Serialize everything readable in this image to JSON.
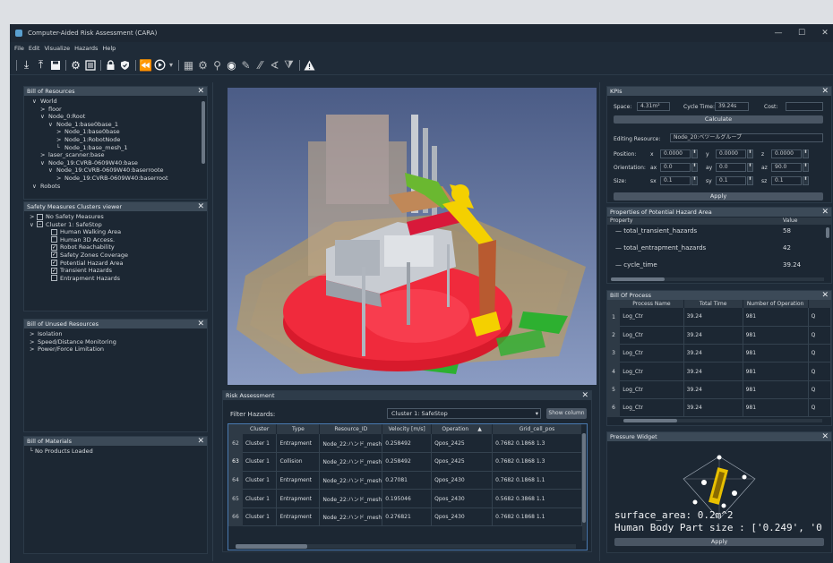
{
  "app": {
    "title": "Computer-Aided Risk Assessment (CARA)",
    "controls": [
      "—",
      "☐",
      "✕"
    ]
  },
  "menu": [
    "File",
    "Edit",
    "Visualize",
    "Hazards",
    "Help"
  ],
  "bom": {
    "title": "Bill of Resources",
    "items": [
      {
        "indent": 1,
        "arrow": "∨",
        "label": "World"
      },
      {
        "indent": 2,
        "arrow": ">",
        "label": "floor"
      },
      {
        "indent": 2,
        "arrow": "∨",
        "label": "Node_0:Root"
      },
      {
        "indent": 3,
        "arrow": "∨",
        "label": "Node_1:base0base_1"
      },
      {
        "indent": 4,
        "arrow": ">",
        "label": "Node_1:base0base"
      },
      {
        "indent": 4,
        "arrow": ">",
        "label": "Node_1:RobotNode"
      },
      {
        "indent": 4,
        "arrow": "└",
        "label": "Node_1:base_mesh_1"
      },
      {
        "indent": 2,
        "arrow": ">",
        "label": "laser_scanner:base"
      },
      {
        "indent": 2,
        "arrow": "∨",
        "label": "Node_19:CVRB-0609W40:base"
      },
      {
        "indent": 3,
        "arrow": "∨",
        "label": "Node_19:CVRB-0609W40:baserroote"
      },
      {
        "indent": 4,
        "arrow": ">",
        "label": "Node_19:CVRB-0609W40:baserroot"
      },
      {
        "indent": 1,
        "arrow": "∨",
        "label": "Robots"
      }
    ]
  },
  "safety": {
    "title": "Safety Measures Clusters viewer",
    "items": [
      {
        "indent": 0,
        "arrow": ">",
        "check": "empty",
        "label": "No Safety Measures"
      },
      {
        "indent": 0,
        "arrow": "∨",
        "check": "partial",
        "label": "Cluster 1: SafeStop"
      },
      {
        "indent": 1,
        "arrow": "",
        "check": "empty",
        "label": "Human Walking Area"
      },
      {
        "indent": 1,
        "arrow": "",
        "check": "empty",
        "label": "Human 3D Access."
      },
      {
        "indent": 1,
        "arrow": "",
        "check": "checked",
        "label": "Robot Reachability"
      },
      {
        "indent": 1,
        "arrow": "",
        "check": "checked",
        "label": "Safety Zones Coverage"
      },
      {
        "indent": 1,
        "arrow": "",
        "check": "checked",
        "label": "Potential Hazard Area"
      },
      {
        "indent": 1,
        "arrow": "",
        "check": "checked",
        "label": "Transient Hazards"
      },
      {
        "indent": 1,
        "arrow": "",
        "check": "empty",
        "label": "Entrapment Hazards"
      }
    ]
  },
  "unused": {
    "title": "Bill of Unused Resources",
    "items": [
      "Isolation",
      "Speed/Distance Monitoring",
      "Power/Force Limitation"
    ]
  },
  "materials": {
    "title": "Bill of Materials",
    "items": [
      "No Products Loaded"
    ]
  },
  "risk": {
    "title": "Risk Assessment",
    "filter_label": "Filter Hazards:",
    "filter_value": "Cluster 1: SafeStop",
    "show_cols": "Show column",
    "columns": [
      "Cluster",
      "Type",
      "Resource_ID",
      "Velocity [m/s]",
      "Operation",
      "Grid_cell_pos"
    ],
    "sort_indicator": "▲",
    "rows": [
      {
        "id": "62",
        "cluster": "Cluster 1",
        "type": "Entrapment",
        "res": "Node_22:ハンド_mesh",
        "vel": "0.258492",
        "op": "Qpos_2425",
        "grid": "0.7682 0.1868 1.3"
      },
      {
        "id": "63",
        "cluster": "Cluster 1",
        "type": "Collision",
        "res": "Node_22:ハンド_mesh",
        "vel": "0.258492",
        "op": "Qpos_2425",
        "grid": "0.7682 0.1868 1.3"
      },
      {
        "id": "64",
        "cluster": "Cluster 1",
        "type": "Entrapment",
        "res": "Node_22:ハンド_mesh",
        "vel": "0.27081",
        "op": "Qpos_2430",
        "grid": "0.7682 0.1868 1.1"
      },
      {
        "id": "65",
        "cluster": "Cluster 1",
        "type": "Entrapment",
        "res": "Node_22:ハンド_mesh",
        "vel": "0.195046",
        "op": "Qpos_2430",
        "grid": "0.5682 0.3868 1.1"
      },
      {
        "id": "66",
        "cluster": "Cluster 1",
        "type": "Entrapment",
        "res": "Node_22:ハンド_mesh",
        "vel": "0.276821",
        "op": "Qpos_2430",
        "grid": "0.7682 0.1868 1.1"
      }
    ]
  },
  "kpis": {
    "title": "KPIs",
    "space_label": "Space:",
    "space_value": "4.31m²",
    "cycle_label": "Cycle Time:",
    "cycle_value": "39.24s",
    "cost_label": "Cost:",
    "cost_value": "",
    "calc_btn": "Calculate",
    "editing_label": "Editing Resource:",
    "editing_value": "Node_20:ベツールグループ",
    "position_label": "Position:",
    "orientation_label": "Orientation:",
    "size_label": "Size:",
    "pos": {
      "x": "0.0000",
      "y": "0.0000",
      "z": "0.0000"
    },
    "ori": {
      "ax": "0.0",
      "ay": "0.0",
      "az": "90.0"
    },
    "size": {
      "sx": "0.1",
      "sy": "0.1",
      "sz": "0.1"
    },
    "labels": {
      "x": "x",
      "y": "y",
      "z": "z",
      "ax": "ax",
      "ay": "ay",
      "az": "az",
      "sx": "sx",
      "sy": "sy",
      "sz": "sz"
    },
    "apply": "Apply"
  },
  "props": {
    "title": "Properties of Potential Hazard Area",
    "col_prop": "Property",
    "col_val": "Value",
    "rows": [
      {
        "name": "total_transient_hazards",
        "value": "58"
      },
      {
        "name": "total_entrapment_hazards",
        "value": "42"
      },
      {
        "name": "cycle_time",
        "value": "39.24"
      }
    ]
  },
  "bop": {
    "title": "Bill Of Process",
    "columns": [
      "Process Name",
      "Total Time",
      "Number of Operation"
    ],
    "rows": [
      {
        "id": "1",
        "name": "Log_Ctr",
        "time": "39.24",
        "ops": "981",
        "q": "Q"
      },
      {
        "id": "2",
        "name": "Log_Ctr",
        "time": "39.24",
        "ops": "981",
        "q": "Q"
      },
      {
        "id": "3",
        "name": "Log_Ctr",
        "time": "39.24",
        "ops": "981",
        "q": "Q"
      },
      {
        "id": "4",
        "name": "Log_Ctr",
        "time": "39.24",
        "ops": "981",
        "q": "Q"
      },
      {
        "id": "5",
        "name": "Log_Ctr",
        "time": "39.24",
        "ops": "981",
        "q": "Q"
      },
      {
        "id": "6",
        "name": "Log_Ctr",
        "time": "39.24",
        "ops": "981",
        "q": "Q"
      }
    ]
  },
  "pressure": {
    "title": "Pressure Widget",
    "line1": "surface_area: 0.2m^2",
    "line2": "Human Body Part size : ['0.249', '0",
    "apply": "Apply"
  },
  "colors": {
    "bg": "#1f2b38",
    "panel_header": "#3c4a58",
    "accent_red": "#e8192e",
    "accent_yellow": "#f4d000"
  }
}
